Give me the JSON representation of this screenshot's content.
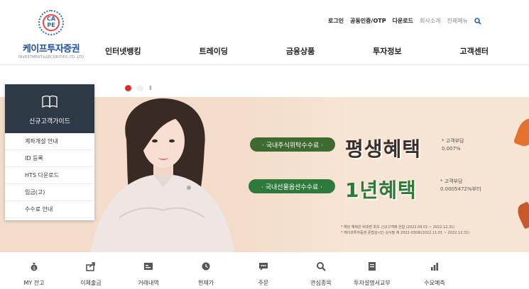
{
  "logo": {
    "badge_text_line1": "CA",
    "badge_text_line2": "PE",
    "name": "케이프투자증권",
    "sub": "INVESTMENT&SECURITIES CO.,LTD"
  },
  "util_menu": {
    "login": "로그인",
    "cert": "공동인증/OTP",
    "download": "다운로드",
    "about": "회사소개",
    "all_menu": "전체메뉴"
  },
  "gnb": [
    "인터넷뱅킹",
    "트레이딩",
    "금융상품",
    "투자정보",
    "고객센터"
  ],
  "banner": {
    "pill1": "· 국내주식위탁수수료 ·",
    "big1": "평생혜택",
    "note1_line1": "* 고객부담",
    "note1_line2": "0.007%",
    "pill2": "· 국내선물옵션수수료 ·",
    "big2": "1년혜택",
    "note2_line1": "* 고객부담",
    "note2_line2": "0.0005472%부터",
    "fine1": "* 해당 혜택은 비대면 최초 신규고객에 한함 (2022.09.01 ~ 2022.12.31)",
    "fine2": "* 케이프투자증권 준법감시인 심사필 제 2022-030호(2022.11.01 ~ 2022.12.31)",
    "pause_symbol": "II",
    "colors": {
      "indicator_active": "#e22b2b",
      "pill1": "#3c6a2f",
      "pill2": "#2e7a3d"
    }
  },
  "guide": {
    "icon": "book-icon",
    "title": "신규고객가이드",
    "items": [
      "계좌개설 안내",
      "ID 등록",
      "HTS 다운로드",
      "입금(고)",
      "수수료 안내"
    ]
  },
  "quick_menu": [
    {
      "icon": "money-bag-icon",
      "label": "MY 잔고"
    },
    {
      "icon": "transfer-icon",
      "label": "이체출금"
    },
    {
      "icon": "receipt-icon",
      "label": "거래내역"
    },
    {
      "icon": "clock-icon",
      "label": "현재가"
    },
    {
      "icon": "chat-icon",
      "label": "주문"
    },
    {
      "icon": "search-icon",
      "label": "관심종목"
    },
    {
      "icon": "document-icon",
      "label": "투자설명서교부"
    },
    {
      "icon": "bar-chart-icon",
      "label": "수요예측"
    }
  ]
}
